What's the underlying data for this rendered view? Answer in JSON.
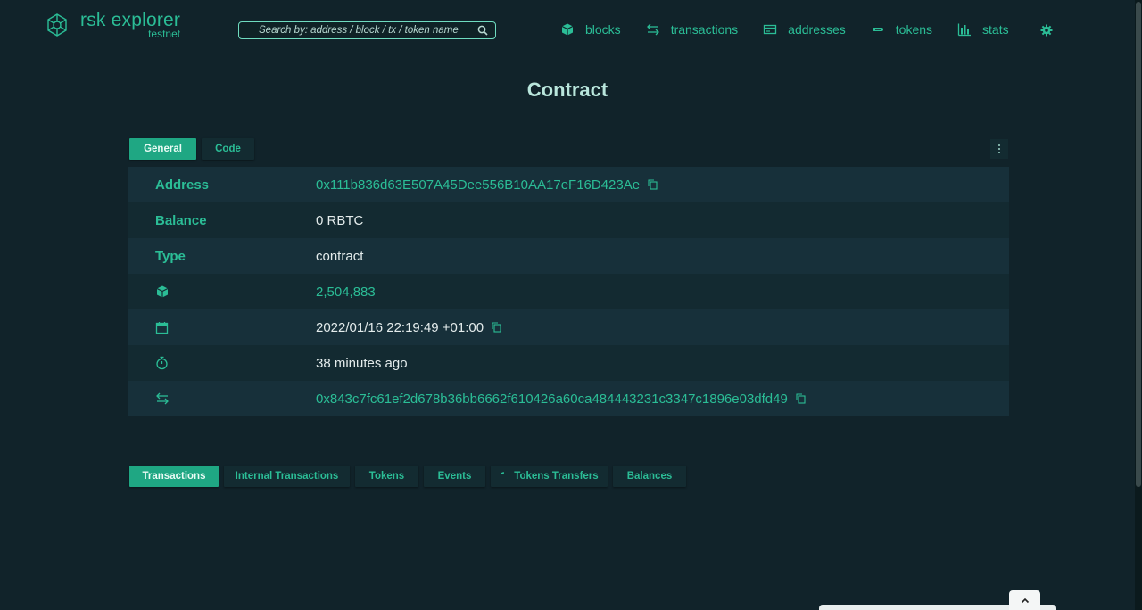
{
  "brand": {
    "title": "rsk explorer",
    "network": "testnet"
  },
  "search": {
    "placeholder": "Search by: address / block / tx / token name"
  },
  "nav": [
    {
      "label": "blocks",
      "icon": "cube-icon"
    },
    {
      "label": "transactions",
      "icon": "transfer-arrows-icon"
    },
    {
      "label": "addresses",
      "icon": "wallet-icon"
    },
    {
      "label": "tokens",
      "icon": "token-icon"
    },
    {
      "label": "stats",
      "icon": "bar-chart-icon"
    }
  ],
  "page": {
    "title": "Contract"
  },
  "tabs": [
    {
      "label": "General",
      "active": true
    },
    {
      "label": "Code",
      "active": false
    }
  ],
  "details": {
    "address": {
      "label": "Address",
      "value": "0x111b836d63E507A45Dee556B10AA17eF16D423Ae"
    },
    "balance": {
      "label": "Balance",
      "value": "0 RBTC"
    },
    "type": {
      "label": "Type",
      "value": "contract"
    },
    "block": {
      "icon": "cube-icon",
      "value": "2,504,883"
    },
    "date": {
      "icon": "calendar-icon",
      "value": "2022/01/16 22:19:49 +01:00"
    },
    "age": {
      "icon": "stopwatch-icon",
      "value": "38 minutes ago"
    },
    "tx": {
      "icon": "transfer-arrows-icon",
      "value": "0x843c7fc61ef2d678b36bb6662f610426a60ca484443231c3347c1896e03dfd49"
    }
  },
  "bottom_tabs": [
    {
      "label": "Transactions",
      "active": true
    },
    {
      "label": "Internal Transactions",
      "active": false
    },
    {
      "label": "Tokens",
      "active": false
    },
    {
      "label": "Events",
      "active": false
    },
    {
      "label": "Tokens Transfers",
      "active": false
    },
    {
      "label": "Balances",
      "active": false
    }
  ],
  "colors": {
    "accent": "#2bbd96",
    "background": "#11232a",
    "active_tab": "#1fa783"
  }
}
